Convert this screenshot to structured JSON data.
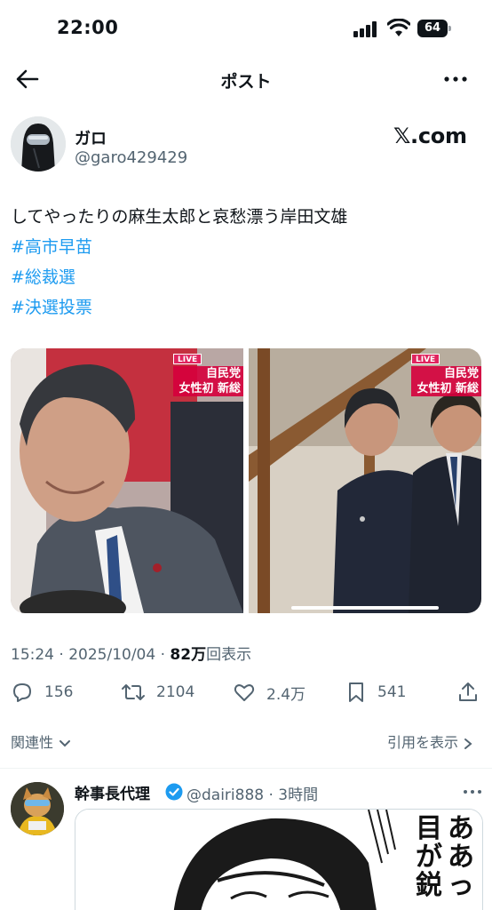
{
  "status_bar": {
    "time": "22:00",
    "battery": "64"
  },
  "nav": {
    "title": "ポスト"
  },
  "author": {
    "name": "ガロ",
    "handle": "@garo429429",
    "source": "𝕏.com"
  },
  "post": {
    "text": "してやったりの麻生太郎と哀愁漂う岸田文雄",
    "hashtags": [
      "#高市早苗",
      "#総裁選",
      "#決選投票"
    ],
    "media": [
      {
        "live": "LIVE",
        "ticker_line1": "自民党",
        "ticker_line2": "女性初 新総"
      },
      {
        "live": "LIVE",
        "ticker_line1": "自民党",
        "ticker_line2": "女性初 新総"
      }
    ]
  },
  "meta": {
    "time_date": "15:24 · 2025/10/04 · ",
    "views": "82万",
    "views_suffix": "回表示"
  },
  "actions": {
    "replies": "156",
    "reposts": "2104",
    "likes": "2.4万",
    "bookmarks": "541"
  },
  "footer_links": {
    "related": "関連性",
    "quotes": "引用を表示"
  },
  "reply": {
    "name": "幹事長代理",
    "handle_time": "@dairi888 · 3時間",
    "manga_col1": "ああっ",
    "manga_col2": "目が鋭"
  },
  "colors": {
    "accent": "#1d9bf0",
    "text": "#0f1419",
    "muted": "#536471"
  }
}
